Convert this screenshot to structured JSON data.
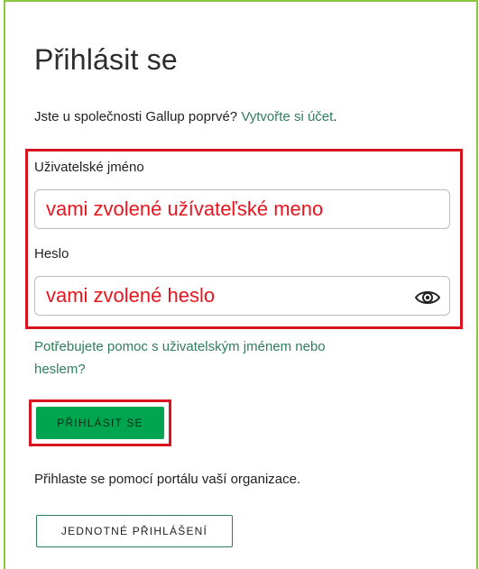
{
  "login": {
    "title": "Přihlásit se",
    "intro_text": "Jste u společnosti Gallup poprvé?",
    "create_account_link": "Vytvořte si účet",
    "intro_suffix": ".",
    "username_label": "Uživatelské jméno",
    "username_value": "vami zvolené užívateľské meno",
    "password_label": "Heslo",
    "password_value": "vami zvolené heslo",
    "help_link": "Potřebujete pomoc s uživatelským jménem nebo heslem?",
    "submit_label": "PŘIHLÁSIT SE",
    "org_text": "Přihlaste se pomocí portálu vaší organizace.",
    "sso_label": "JEDNOTNÉ PŘIHLÁŠENÍ"
  },
  "icons": {
    "password_toggle": "eye-icon"
  },
  "colors": {
    "accent_green": "#00a64f",
    "link_green": "#2f7d5a",
    "highlight_red": "#d7141f",
    "annotation_red": "#e8141e",
    "frame_green": "#8cc63f"
  }
}
